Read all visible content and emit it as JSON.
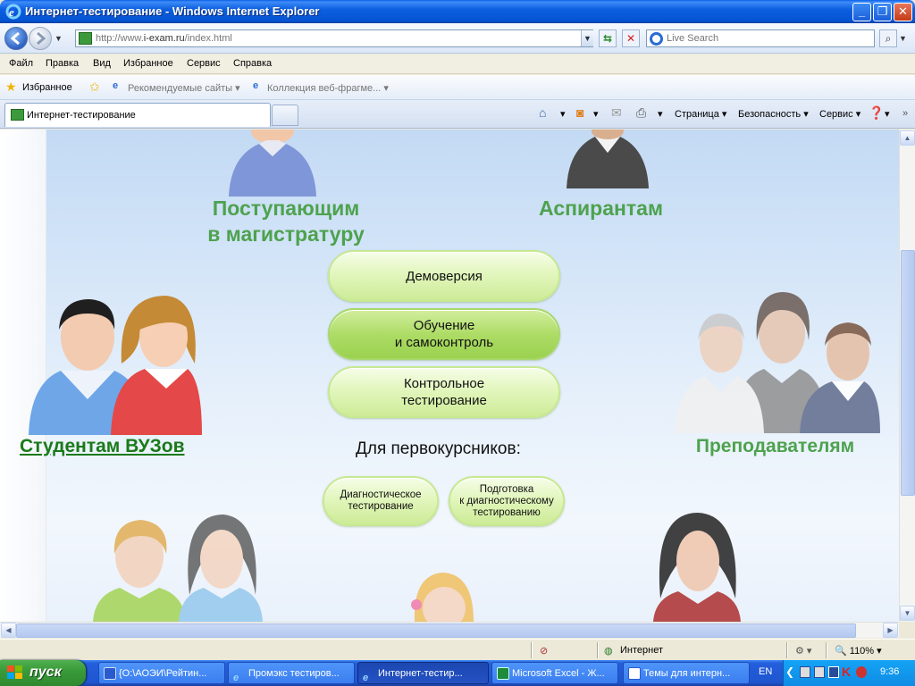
{
  "window": {
    "title": "Интернет-тестирование - Windows Internet Explorer"
  },
  "address_bar": {
    "url_prefix": "http://www.",
    "url_domain": "i-exam.ru",
    "url_suffix": "/index.html",
    "search_placeholder": "Live Search"
  },
  "menu": [
    "Файл",
    "Правка",
    "Вид",
    "Избранное",
    "Сервис",
    "Справка"
  ],
  "favorites_bar": {
    "favorites_label": "Избранное",
    "suggested_sites": "Рекомендуемые сайты",
    "web_slice_gallery": "Коллекция веб-фрагме..."
  },
  "tabs": {
    "active_tab": "Интернет-тестирование"
  },
  "command_bar": {
    "page": "Страница",
    "safety": "Безопасность",
    "tools": "Сервис"
  },
  "page": {
    "heading_masters": "Поступающим\nв магистратуру",
    "heading_postgrad": "Аспирантам",
    "students_link": "Студентам ВУЗов",
    "heading_teachers": "Преподавателям",
    "btn_demo": "Демоверсия",
    "btn_training": "Обучение\nи самоконтроль",
    "btn_control": "Контрольное\nтестирование",
    "freshmen_label": "Для первокурсников:",
    "btn_diagnostic": "Диагностическое\nтестирование",
    "btn_prep": "Подготовка\nк диагностическому\nтестированию"
  },
  "status_bar": {
    "zone": "Интернет",
    "zoom": "110%"
  },
  "taskbar": {
    "start_label": "пуск",
    "items": [
      "{O:\\АОЭИ\\Рейтин...",
      "Промэкс тестиров...",
      "Интернет-тестир...",
      "Microsoft Excel - Ж...",
      "Темы для интерн..."
    ],
    "language": "EN",
    "clock": "9:36"
  },
  "colors": {
    "heading_green": "#4ea24e",
    "link_green": "#1a7a1a",
    "pill_green": "#cdeb97",
    "xp_blue": "#245edb"
  }
}
